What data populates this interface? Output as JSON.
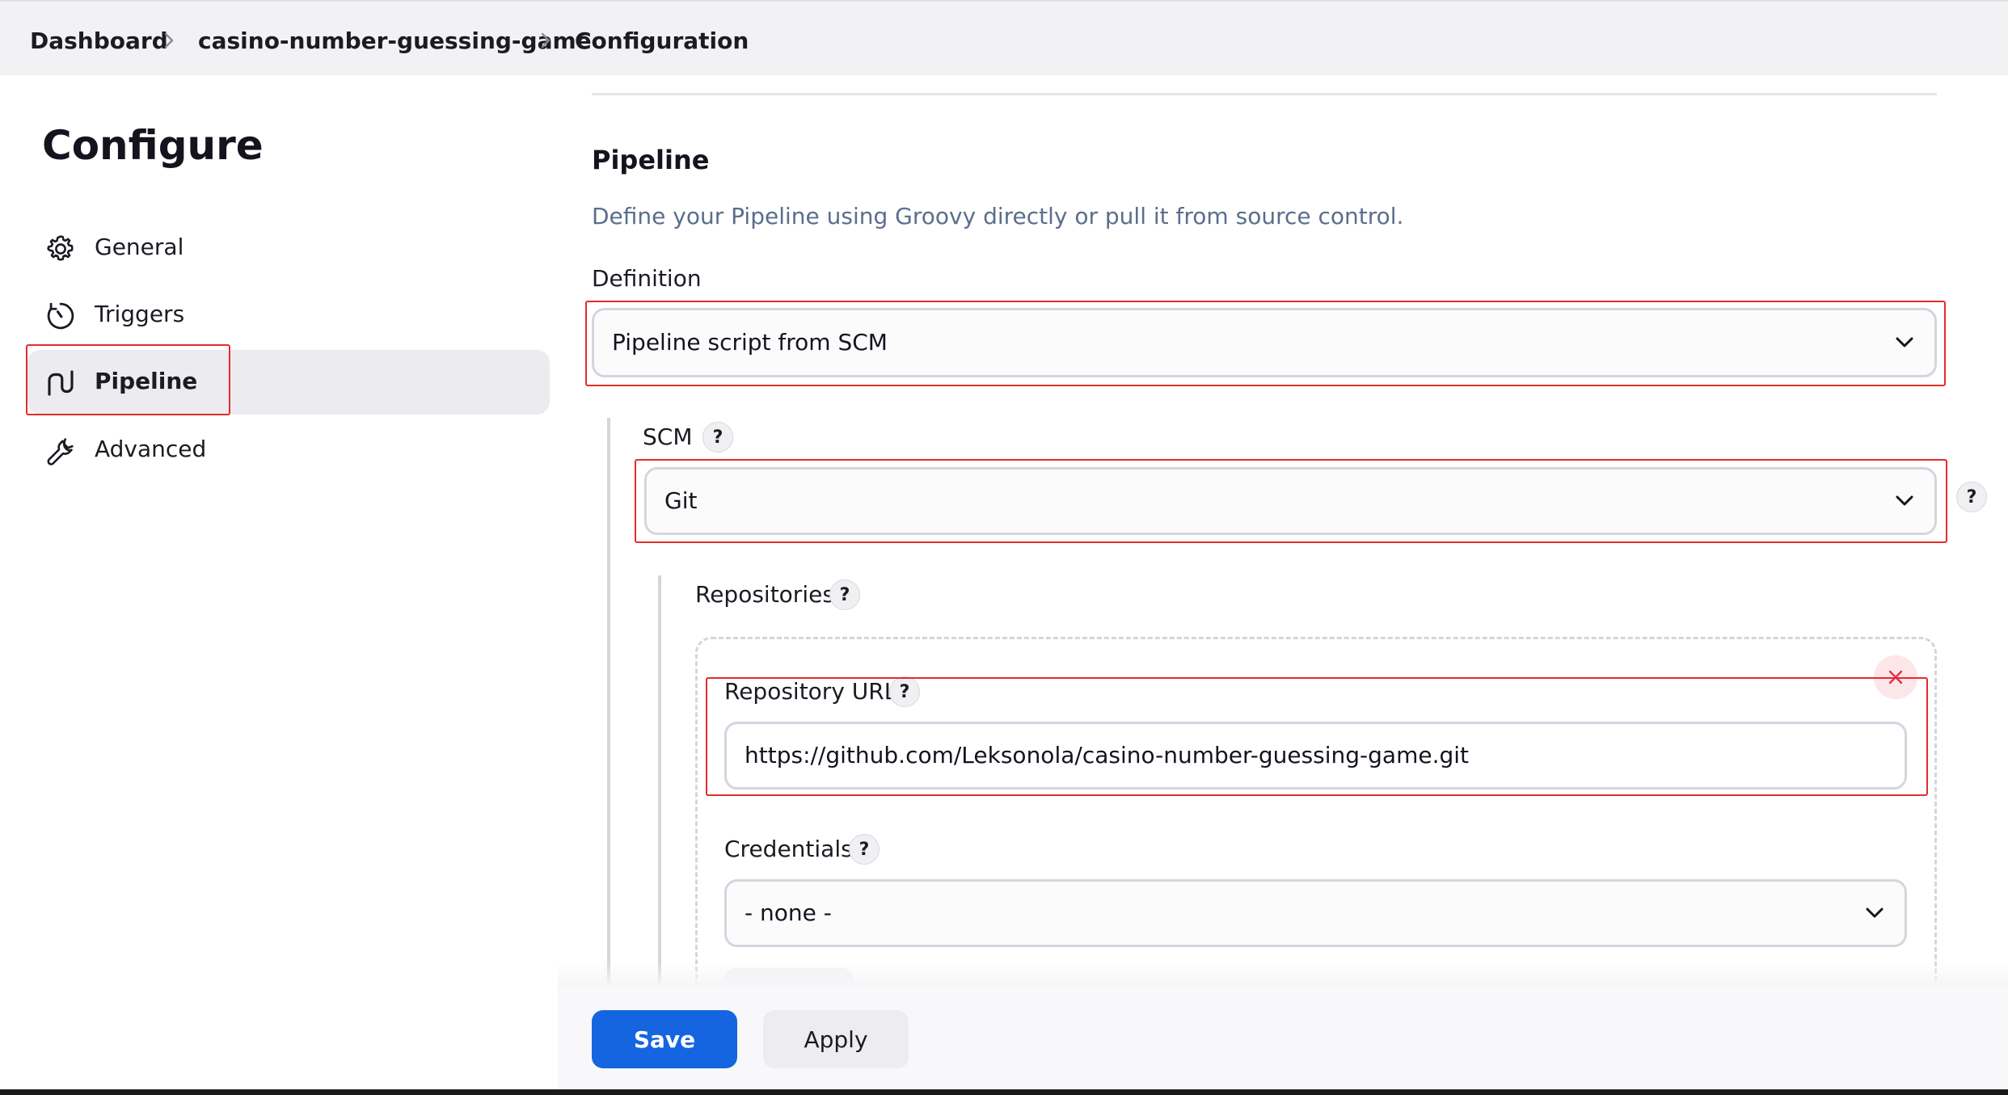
{
  "breadcrumb": {
    "items": [
      "Dashboard",
      "casino-number-guessing-game",
      "Configuration"
    ]
  },
  "sidebar": {
    "title": "Configure",
    "items": [
      {
        "label": "General",
        "icon": "gear-icon"
      },
      {
        "label": "Triggers",
        "icon": "clock-icon"
      },
      {
        "label": "Pipeline",
        "icon": "pipeline-icon",
        "active": true
      },
      {
        "label": "Advanced",
        "icon": "wrench-icon"
      }
    ]
  },
  "pipeline": {
    "title": "Pipeline",
    "description": "Define your Pipeline using Groovy directly or pull it from source control.",
    "definition_label": "Definition",
    "definition_value": "Pipeline script from SCM",
    "scm_label": "SCM",
    "scm_value": "Git",
    "repositories_label": "Repositories",
    "repo_url_label": "Repository URL",
    "repo_url_value": "https://github.com/Leksonola/casino-number-guessing-game.git",
    "credentials_label": "Credentials",
    "credentials_value": "- none -",
    "help_glyph": "?"
  },
  "actions": {
    "save_label": "Save",
    "apply_label": "Apply"
  },
  "colors": {
    "accent": "#1565e0",
    "highlight_outline": "#e32c2c",
    "description_text": "#5a6e8c"
  }
}
